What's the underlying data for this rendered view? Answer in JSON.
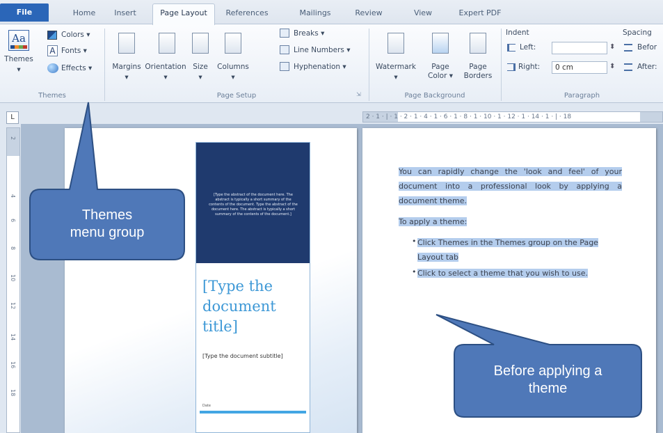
{
  "tabs": {
    "file": "File",
    "home": "Home",
    "insert": "Insert",
    "page_layout": "Page Layout",
    "references": "References",
    "mailings": "Mailings",
    "review": "Review",
    "view": "View",
    "expert_pdf": "Expert PDF"
  },
  "ribbon": {
    "themes_group": {
      "label": "Themes",
      "themes_button": "Themes",
      "themes_icon_text": "Aa",
      "colors": "Colors ▾",
      "fonts": "Fonts ▾",
      "fonts_icon_text": "A",
      "effects": "Effects ▾"
    },
    "page_setup": {
      "label": "Page Setup",
      "margins": "Margins",
      "orientation": "Orientation",
      "size": "Size",
      "columns": "Columns",
      "breaks": "Breaks ▾",
      "line_numbers": "Line Numbers ▾",
      "hyphenation": "Hyphenation ▾"
    },
    "page_background": {
      "label": "Page Background",
      "watermark": "Watermark",
      "page_color": "Page\nColor ▾",
      "page_borders": "Page\nBorders"
    },
    "paragraph": {
      "label": "Paragraph",
      "indent": "Indent",
      "left_label": "Left:",
      "left_value": "",
      "right_label": "Right:",
      "right_value": "0 cm",
      "spacing": "Spacing",
      "before_label": "Befor",
      "after_label": "After:"
    }
  },
  "ruler": {
    "corner": "L",
    "top_ticks": "2 · 1 · | · 1 · 2 · 1 · 4 · 1 · 6 · 1 · 8 · 1 · 10 · 1 · 12 · 1 · 14 · 1 · | · 18",
    "left_ticks": [
      "2",
      "4",
      "6",
      "8",
      "10",
      "12",
      "14",
      "16",
      "18"
    ]
  },
  "cover_page": {
    "abstract": "[Type the abstract of the document here. The abstract is typically a short summary of the contents of the document. Type the abstract of the document here. The abstract is typically a short summary of the contents of the document.]",
    "title": "[Type the document title]",
    "subtitle": "[Type the document subtitle]",
    "date": "Date"
  },
  "page_text": {
    "para1": "You can rapidly change the 'look and feel' of your document into a professional look by applying a document theme.",
    "para2": "To apply a theme:",
    "bullet1": "Click Themes in the Themes group on the Page Layout tab",
    "bullet2": "Click to select a theme that you wish to use."
  },
  "callouts": {
    "themes_menu_group": "Themes\nmenu group",
    "before_applying": "Before applying a\ntheme"
  },
  "colors": {
    "callout_fill": "#4f78b8",
    "callout_stroke": "#2c4f83",
    "file_tab": "#2b66b8",
    "cover_band": "#1f3a6e",
    "title_blue": "#3d98d6"
  }
}
